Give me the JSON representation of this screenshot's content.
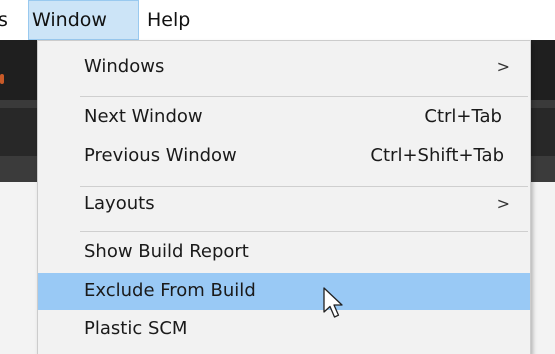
{
  "menubar": {
    "items": [
      {
        "label": "s"
      },
      {
        "label": "Window"
      },
      {
        "label": "Help"
      }
    ]
  },
  "dropdown": {
    "items": [
      {
        "label": "Windows",
        "shortcut": "",
        "submenu": true
      },
      {
        "label": "Next Window",
        "shortcut": "Ctrl+Tab",
        "submenu": false
      },
      {
        "label": "Previous Window",
        "shortcut": "Ctrl+Shift+Tab",
        "submenu": false
      },
      {
        "label": "Layouts",
        "shortcut": "",
        "submenu": true
      },
      {
        "label": "Show Build Report",
        "shortcut": "",
        "submenu": false
      },
      {
        "label": "Exclude From Build",
        "shortcut": "",
        "submenu": false,
        "highlighted": true
      },
      {
        "label": "Plastic SCM",
        "shortcut": "",
        "submenu": false
      }
    ]
  },
  "icons": {
    "submenu_arrow": ">",
    "cursor": "mouse-pointer"
  },
  "colors": {
    "menu_background": "#f2f2f2",
    "highlight": "#99c9f5",
    "menubar_active": "#cce4f7"
  }
}
